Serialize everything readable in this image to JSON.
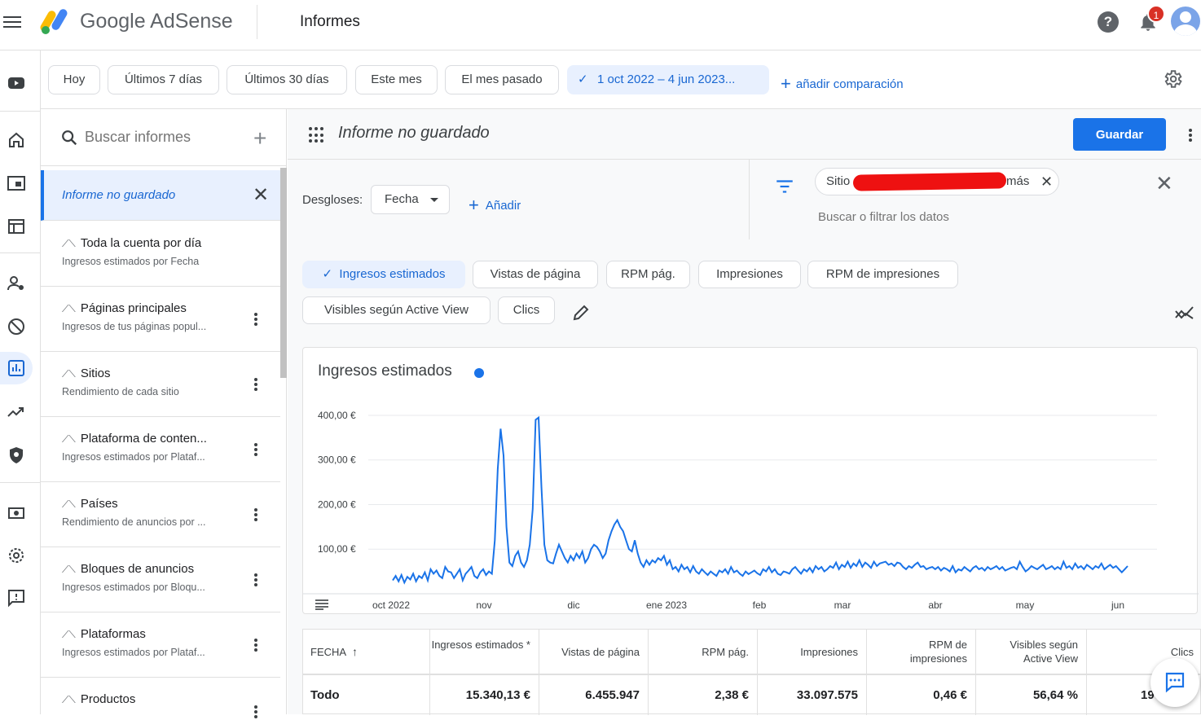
{
  "app": {
    "brand": "Google AdSense",
    "page_title": "Informes",
    "notification_count": "1"
  },
  "date_chips": [
    "Hoy",
    "Últimos 7 días",
    "Últimos 30 días",
    "Este mes",
    "El mes pasado"
  ],
  "date_range": "1 oct 2022 – 4 jun 2023...",
  "add_comparison": "añadir comparación",
  "sidebar": {
    "search_placeholder": "Buscar informes",
    "unsaved": "Informe no guardado",
    "reports": [
      {
        "title": "Toda la cuenta por día",
        "sub": "Ingresos estimados por Fecha"
      },
      {
        "title": "Páginas principales",
        "sub": "Ingresos de tus páginas popul..."
      },
      {
        "title": "Sitios",
        "sub": "Rendimiento de cada sitio"
      },
      {
        "title": "Plataforma de conten...",
        "sub": "Ingresos estimados por Plataf..."
      },
      {
        "title": "Países",
        "sub": "Rendimiento de anuncios por ..."
      },
      {
        "title": "Bloques de anuncios",
        "sub": "Ingresos estimados por Bloqu..."
      },
      {
        "title": "Plataformas",
        "sub": "Ingresos estimados por Plataf..."
      },
      {
        "title": "Productos",
        "sub": ""
      }
    ]
  },
  "main": {
    "report_name": "Informe no guardado",
    "save_label": "Guardar",
    "breakdowns_label": "Desgloses:",
    "breakdown_value": "Fecha",
    "add_breakdown": "Añadir",
    "filter_chip_prefix": "Sitio",
    "filter_chip_suffix": "más",
    "filter_placeholder": "Buscar o filtrar los datos"
  },
  "metrics": [
    "Ingresos estimados",
    "Vistas de página",
    "RPM pág.",
    "Impresiones",
    "RPM de impresiones",
    "Visibles según Active View",
    "Clics"
  ],
  "colors": {
    "accent": "#1a73e8",
    "selected_bg": "#e8f0fe",
    "redaction": "#ee1111"
  },
  "chart_data": {
    "type": "line",
    "title": "Ingresos estimados",
    "yticks": [
      "100,00 €",
      "200,00 €",
      "300,00 €",
      "400,00 €"
    ],
    "xticks": [
      "oct 2022",
      "nov",
      "dic",
      "ene 2023",
      "feb",
      "mar",
      "abr",
      "may",
      "jun"
    ],
    "xlabel": "",
    "ylabel": "",
    "ylim": [
      0,
      420
    ],
    "grid": true,
    "series": [
      {
        "values": [
          30,
          40,
          28,
          42,
          25,
          38,
          32,
          45,
          28,
          40,
          35,
          48,
          30,
          55,
          45,
          52,
          40,
          35,
          60,
          50,
          48,
          35,
          45,
          55,
          30,
          45,
          52,
          60,
          40,
          35,
          48,
          55,
          42,
          50,
          45,
          120,
          280,
          370,
          310,
          150,
          70,
          62,
          85,
          95,
          70,
          60,
          75,
          110,
          190,
          390,
          395,
          240,
          110,
          75,
          70,
          68,
          90,
          110,
          95,
          80,
          70,
          85,
          75,
          90,
          80,
          95,
          70,
          80,
          100,
          110,
          105,
          95,
          80,
          90,
          120,
          140,
          155,
          165,
          150,
          140,
          120,
          100,
          95,
          120,
          90,
          70,
          60,
          75,
          65,
          75,
          70,
          80,
          75,
          85,
          65,
          75,
          55,
          60,
          50,
          65,
          55,
          60,
          48,
          62,
          50,
          45,
          55,
          48,
          42,
          50,
          45,
          40,
          52,
          48,
          55,
          45,
          60,
          48,
          52,
          45,
          40,
          50,
          44,
          48,
          52,
          46,
          42,
          55,
          50,
          60,
          48,
          55,
          45,
          42,
          50,
          48,
          45,
          55,
          60,
          52,
          45,
          55,
          50,
          58,
          48,
          62,
          55,
          60,
          50,
          55,
          62,
          58,
          70,
          55,
          65,
          60,
          72,
          58,
          68,
          62,
          75,
          60,
          70,
          65,
          58,
          72,
          62,
          68,
          70,
          72,
          65,
          68,
          62,
          70,
          68,
          60,
          55,
          62,
          58,
          65,
          70,
          60,
          62,
          55,
          58,
          60,
          55,
          60,
          52,
          58,
          55,
          50,
          62,
          48,
          55,
          52,
          60,
          55,
          50,
          58,
          62,
          55,
          58,
          52,
          60,
          55,
          58,
          62,
          55,
          60,
          52,
          55,
          58,
          60,
          55,
          72,
          60,
          50,
          55,
          62,
          58,
          55,
          60,
          65,
          55,
          58,
          62,
          55,
          60,
          55,
          72,
          58,
          62,
          55,
          68,
          58,
          62,
          55,
          65,
          60,
          55,
          62,
          58,
          68,
          55,
          60,
          65,
          58,
          62,
          55,
          48,
          55,
          62
        ]
      }
    ]
  },
  "table": {
    "headers": [
      "FECHA",
      "Ingresos estimados *",
      "Vistas de página",
      "RPM pág.",
      "Impresiones",
      "RPM de impresiones",
      "Visibles según Active View",
      "Clics"
    ],
    "total_row": [
      "Todo",
      "15.340,13 €",
      "6.455.947",
      "2,38 €",
      "33.097.575",
      "0,46 €",
      "56,64 %",
      "19"
    ]
  }
}
